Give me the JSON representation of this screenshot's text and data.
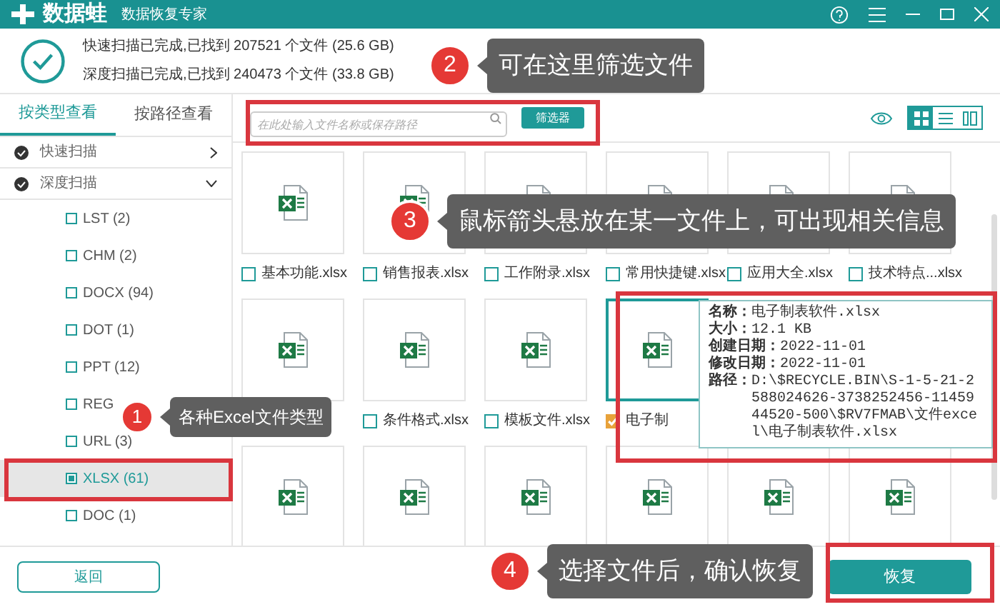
{
  "window": {
    "logo": "数据蛙",
    "subtitle": "数据恢复专家"
  },
  "scan_summary": [
    "快速扫描已完成,已找到 207521 个文件 (25.6 GB)",
    "深度扫描已完成,已找到 240473 个文件 (33.8 GB)"
  ],
  "sidebar": {
    "tabs": [
      {
        "label": "按类型查看",
        "selected": true
      },
      {
        "label": "按路径查看",
        "selected": false
      }
    ],
    "groups": [
      {
        "label": "快速扫描",
        "expanded": false
      },
      {
        "label": "深度扫描",
        "expanded": true,
        "children": [
          {
            "label": "LST (2)",
            "checked": false,
            "selected": false
          },
          {
            "label": "CHM (2)",
            "checked": false,
            "selected": false
          },
          {
            "label": "DOCX (94)",
            "checked": false,
            "selected": false
          },
          {
            "label": "DOT (1)",
            "checked": false,
            "selected": false
          },
          {
            "label": "PPT (12)",
            "checked": false,
            "selected": false
          },
          {
            "label": "REG",
            "checked": false,
            "selected": false
          },
          {
            "label": "URL (3)",
            "checked": false,
            "selected": false
          },
          {
            "label": "XLSX (61)",
            "checked": true,
            "selected": true
          },
          {
            "label": "DOC (1)",
            "checked": false,
            "selected": false
          }
        ]
      }
    ]
  },
  "toolbar": {
    "search": {
      "placeholder": "在此处输入文件名称或保存路径"
    },
    "filter_button": "筛选器",
    "views": [
      {
        "kind": "grid",
        "selected": true
      },
      {
        "kind": "list",
        "selected": false
      },
      {
        "kind": "detail",
        "selected": false
      }
    ]
  },
  "file_rows": [
    [
      {
        "name": "基本功能.xlsx",
        "checked": false,
        "hovered": false
      },
      {
        "name": "销售报表.xlsx",
        "checked": false,
        "hovered": false
      },
      {
        "name": "工作附录.xlsx",
        "checked": false,
        "hovered": false
      },
      {
        "name": "常用快捷键.xlsx",
        "checked": false,
        "hovered": false
      },
      {
        "name": "应用大全.xlsx",
        "checked": false,
        "hovered": false
      },
      {
        "name": "技术特点...xlsx",
        "checked": false,
        "hovered": false
      }
    ],
    [
      {
        "hovered": false
      },
      {
        "name": "条件格式.xlsx",
        "checked": false,
        "hovered": false
      },
      {
        "name": "模板文件.xlsx",
        "checked": false,
        "hovered": false
      },
      {
        "name": "电子制",
        "checked": true,
        "hovered": true
      }
    ],
    [
      {
        "hovered": false
      },
      {
        "hovered": false
      },
      {
        "hovered": false
      },
      {
        "hovered": false
      },
      {
        "hovered": false
      },
      {
        "hovered": false
      }
    ]
  ],
  "tooltip": {
    "fields": [
      {
        "label": "名称：",
        "value": "电子制表软件.xlsx"
      },
      {
        "label": "大小：",
        "value": "12.1 KB"
      },
      {
        "label": "创建日期：",
        "value": "2022-11-01"
      },
      {
        "label": "修改日期：",
        "value": "2022-11-01"
      },
      {
        "label": "路径：",
        "value": "D:\\$RECYCLE.BIN\\S-1-5-21-2588024626-3738252456-1145944520-500\\$RV7FMAB\\文件excel\\电子制表软件.xlsx"
      }
    ]
  },
  "footer": {
    "back_button": "返回",
    "recover_button": "恢复"
  },
  "annotations": [
    {
      "number": "1",
      "text": "各种Excel文件类型"
    },
    {
      "number": "2",
      "text": "可在这里筛选文件"
    },
    {
      "number": "3",
      "text": "鼠标箭头悬放在某一文件上，可出现相关信息"
    },
    {
      "number": "4",
      "text": "选择文件后，确认恢复"
    }
  ]
}
